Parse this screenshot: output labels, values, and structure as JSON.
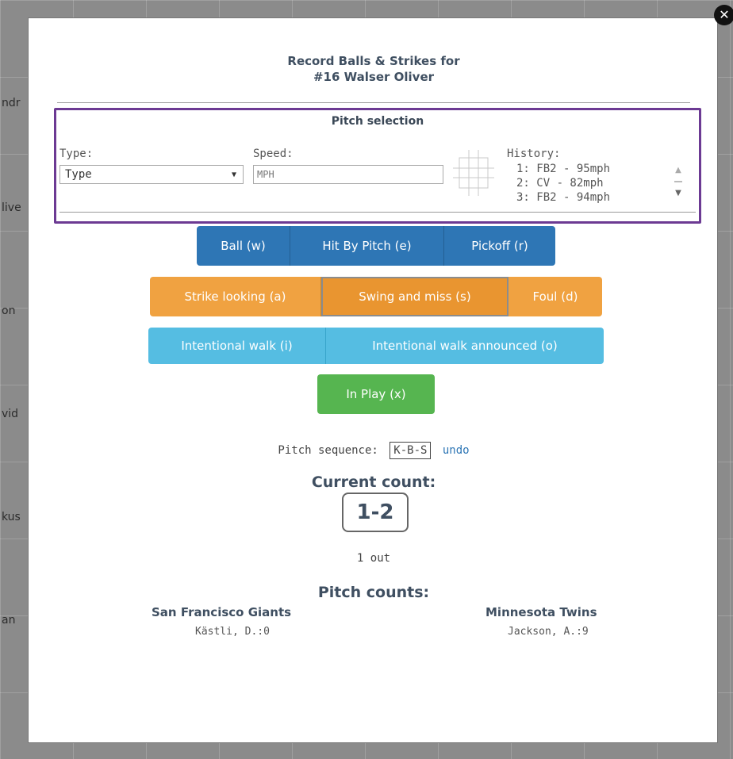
{
  "background": {
    "row_labels": [
      "ndr",
      "live",
      "on",
      "vid",
      "kus",
      "an"
    ]
  },
  "modal": {
    "title_line1": "Record Balls & Strikes for",
    "title_line2": "#16 Walser Oliver"
  },
  "pitch_selection": {
    "title": "Pitch selection",
    "type_label": "Type:",
    "type_value": "Type",
    "speed_label": "Speed:",
    "speed_placeholder": "MPH",
    "history_label": "History:",
    "history": [
      "1: FB2 - 95mph",
      "2: CV - 82mph",
      "3: FB2 - 94mph"
    ]
  },
  "buttons": {
    "row1": [
      "Ball (w)",
      "Hit By Pitch (e)",
      "Pickoff (r)"
    ],
    "row2": [
      "Strike looking (a)",
      "Swing and miss (s)",
      "Foul (d)"
    ],
    "row3": [
      "Intentional walk (i)",
      "Intentional walk announced (o)"
    ],
    "row4": [
      "In Play (x)"
    ]
  },
  "sequence": {
    "label": "Pitch sequence:",
    "value": "K-B-S",
    "undo": "undo"
  },
  "count": {
    "title": "Current count:",
    "value": "1-2",
    "outs": "1 out"
  },
  "pitch_counts": {
    "title": "Pitch counts:",
    "home_team": "San Francisco Giants",
    "home_pitcher": "Kästli, D.:0",
    "away_team": "Minnesota Twins",
    "away_pitcher": "Jackson, A.:9"
  },
  "colors": {
    "primary": "#2e76b5",
    "warning": "#f0a241",
    "info": "#55bde2",
    "success": "#56b550",
    "panel_border": "#6c3a93"
  }
}
